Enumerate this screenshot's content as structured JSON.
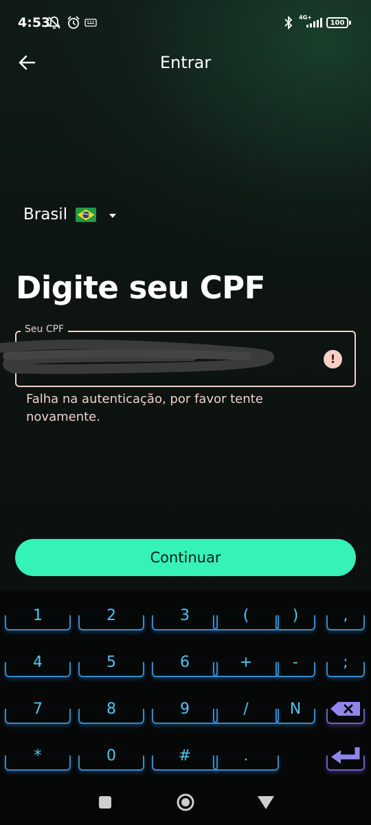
{
  "status_bar": {
    "time": "4:53",
    "network": "4G+",
    "battery": "100",
    "icons": [
      "muted-notification-icon",
      "alarm-icon",
      "keyboard-icon",
      "bluetooth-icon",
      "signal-icon"
    ]
  },
  "header": {
    "title": "Entrar",
    "back_icon": "arrow-left-icon"
  },
  "country": {
    "name": "Brasil",
    "flag": "brazil-flag-icon"
  },
  "heading": "Digite seu CPF",
  "cpf_input": {
    "label": "Seu CPF",
    "value": "",
    "error_message": "Falha na autenticação, por favor tente novamente."
  },
  "continue_label": "Continuar",
  "keyboard": {
    "rows": [
      [
        "1",
        "2",
        "3",
        "(",
        ")",
        ","
      ],
      [
        "4",
        "5",
        "6",
        "+",
        "-",
        ";"
      ],
      [
        "7",
        "8",
        "9",
        "/",
        "N",
        "⌫"
      ],
      [
        "*",
        "0",
        "#",
        ".",
        "⏎"
      ]
    ]
  },
  "colors": {
    "accent": "#35f2b7",
    "error": "#f2d3cc",
    "key_text": "#4fc6f4",
    "key_action": "#8f86ee"
  }
}
